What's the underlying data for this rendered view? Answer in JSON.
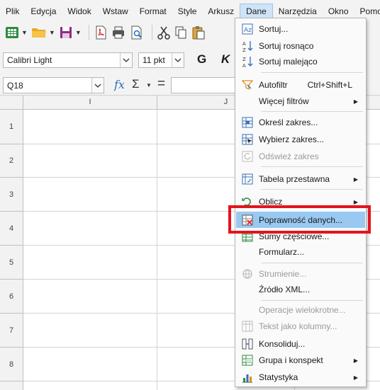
{
  "menubar": {
    "items": [
      "Plik",
      "Edycja",
      "Widok",
      "Wstaw",
      "Format",
      "Style",
      "Arkusz",
      "Dane",
      "Narzędzia",
      "Okno",
      "Pomoc"
    ],
    "active": "Dane"
  },
  "format_bar": {
    "font_name": "Calibri Light",
    "font_size": "11 pkt",
    "bold_letter": "G",
    "italic_letter": "K"
  },
  "formula_bar": {
    "name_box": "Q18",
    "fx": "fx",
    "sum": "Σ",
    "equals": "="
  },
  "sheet": {
    "columns": [
      "I",
      "J"
    ],
    "rows": [
      "1",
      "2",
      "3",
      "4",
      "5",
      "6",
      "7",
      "8"
    ]
  },
  "dane_menu": {
    "items": [
      {
        "label": "Sortuj...",
        "icon": "sort-icon"
      },
      {
        "label": "Sortuj rosnąco",
        "icon": "sort-ascending-icon"
      },
      {
        "label": "Sortuj malejąco",
        "icon": "sort-descending-icon"
      },
      {
        "label": "Autofiltr",
        "shortcut": "Ctrl+Shift+L",
        "icon": "autofilter-icon"
      },
      {
        "label": "Więcej filtrów",
        "submenu": true
      },
      {
        "label": "Określ zakres...",
        "icon": "define-range-icon"
      },
      {
        "label": "Wybierz zakres...",
        "icon": "select-range-icon"
      },
      {
        "label": "Odśwież zakres",
        "disabled": true,
        "icon": "refresh-range-icon"
      },
      {
        "label": "Tabela przestawna",
        "submenu": true,
        "icon": "pivot-table-icon"
      },
      {
        "label": "Oblicz",
        "submenu": true,
        "icon": "calculate-icon"
      },
      {
        "label": "Poprawność danych...",
        "highlighted": true,
        "icon": "validity-icon"
      },
      {
        "label": "Sumy częściowe...",
        "icon": "subtotals-icon"
      },
      {
        "label": "Formularz..."
      },
      {
        "label": "Strumienie...",
        "disabled": true,
        "icon": "streams-icon"
      },
      {
        "label": "Źródło XML..."
      },
      {
        "label": "Operacje wielokrotne...",
        "disabled": true
      },
      {
        "label": "Tekst jako kolumny...",
        "disabled": true,
        "icon": "text-to-columns-icon"
      },
      {
        "label": "Konsoliduj...",
        "icon": "consolidate-icon"
      },
      {
        "label": "Grupa i konspekt",
        "submenu": true,
        "icon": "group-outline-icon"
      },
      {
        "label": "Statystyka",
        "submenu": true,
        "icon": "statistics-icon"
      }
    ]
  },
  "colors": {
    "highlight": "#99c9f1",
    "annotation_box": "#e3141c",
    "active_menu": "#cfe4f8"
  }
}
